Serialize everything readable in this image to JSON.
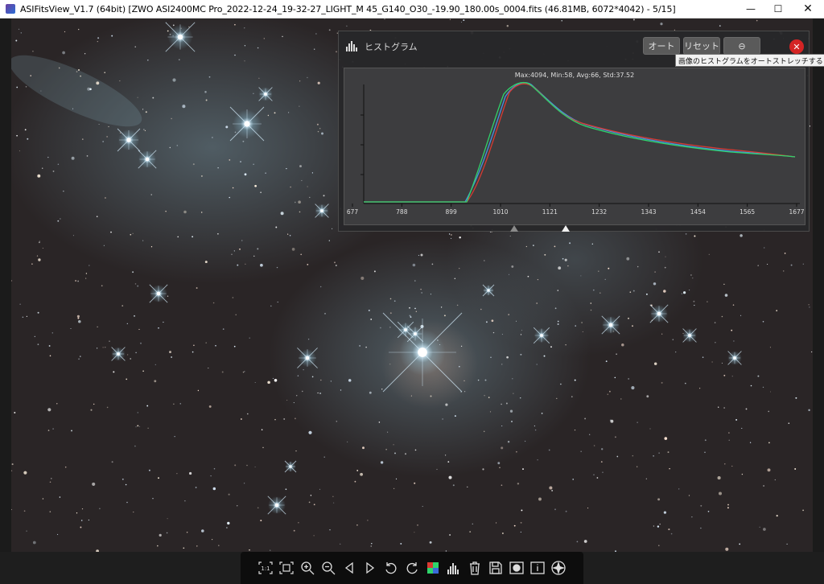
{
  "window": {
    "title": "ASIFitsView_V1.7 (64bit) [ZWO ASI2400MC Pro_2022-12-24_19-32-27_LIGHT_M 45_G140_O30_-19.90_180.00s_0004.fits (46.81MB, 6072*4042) - 5/15]",
    "minimize": "—",
    "maximize": "☐",
    "close": "✕"
  },
  "histogram": {
    "title": "ヒストグラム",
    "auto_label": "オート",
    "reset_label": "リセット",
    "close_label": "✕",
    "tooltip": "画像のヒストグラムをオートストレッチする",
    "stats": "Max:4094, Min:58, Avg:66, Std:37.52",
    "x_ticks": [
      "677",
      "788",
      "899",
      "1010",
      "1121",
      "1232",
      "1343",
      "1454",
      "1565",
      "1677"
    ],
    "colors": {
      "red": "#d83a32",
      "green": "#2fd46a",
      "blue": "#4a90e0"
    }
  },
  "toolbar": {
    "icons": [
      "fit-width-icon",
      "fit-window-icon",
      "zoom-in-icon",
      "zoom-out-icon",
      "previous-icon",
      "next-icon",
      "rotate-left-icon",
      "rotate-right-icon",
      "debayer-icon",
      "histogram-icon",
      "delete-icon",
      "save-icon",
      "stretch-icon",
      "info-icon",
      "star-detect-icon"
    ]
  }
}
